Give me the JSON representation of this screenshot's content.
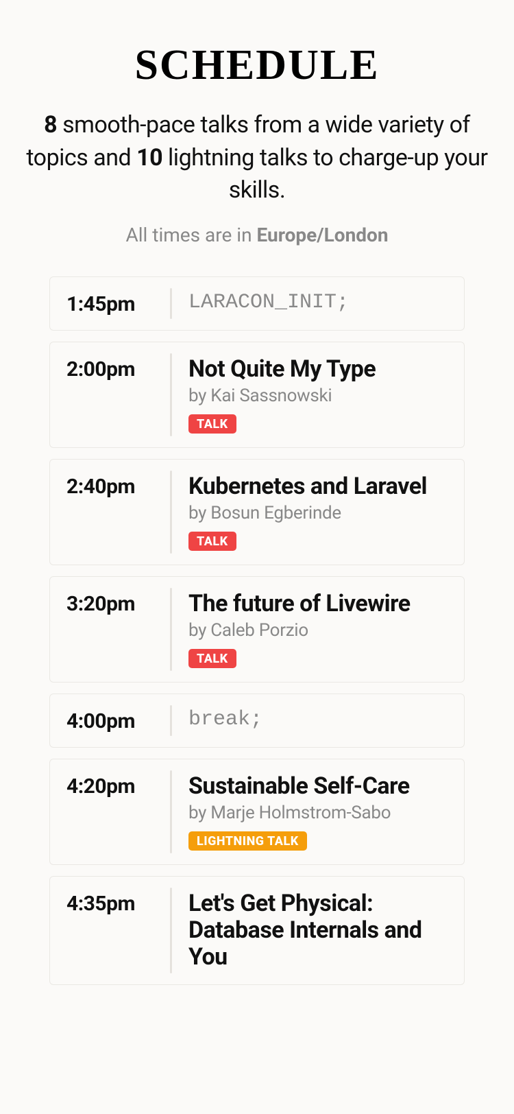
{
  "header": {
    "title": "Schedule",
    "subtitle_num_talks": "8",
    "subtitle_part1": " smooth-pace talks from a wide variety of topics and ",
    "subtitle_num_lightning": "10",
    "subtitle_part2": " lightning talks to charge-up your skills.",
    "tz_prefix": "All times are in ",
    "timezone": "Europe/London"
  },
  "badges": {
    "talk": "TALK",
    "lightning": "LIGHTNING TALK"
  },
  "schedule": [
    {
      "time": "1:45pm",
      "kind": "code",
      "title": "LARACON_INIT;"
    },
    {
      "time": "2:00pm",
      "kind": "talk",
      "title": "Not Quite My Type",
      "by": "by Kai Sassnowski",
      "badge": "talk"
    },
    {
      "time": "2:40pm",
      "kind": "talk",
      "title": "Kubernetes and Laravel",
      "by": "by Bosun Egberinde",
      "badge": "talk"
    },
    {
      "time": "3:20pm",
      "kind": "talk",
      "title": "The future of Livewire",
      "by": "by Caleb Porzio",
      "badge": "talk"
    },
    {
      "time": "4:00pm",
      "kind": "code",
      "title": "break;"
    },
    {
      "time": "4:20pm",
      "kind": "talk",
      "title": "Sustainable Self-Care",
      "by": "by Marje Holmstrom-Sabo",
      "badge": "lightning"
    },
    {
      "time": "4:35pm",
      "kind": "talk",
      "title": "Let's Get Physical: Database Internals and You"
    }
  ]
}
